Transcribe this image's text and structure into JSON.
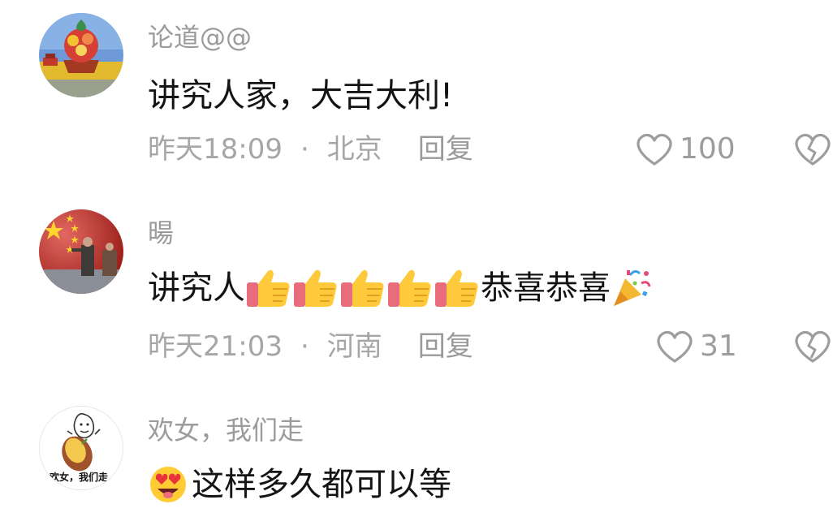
{
  "comments": [
    {
      "username": "论道@@",
      "text": "讲究人家，大吉大利!",
      "time": "昨天18:09",
      "separator": "·",
      "location": "北京",
      "reply_label": "回复",
      "likes": "100",
      "avatar_icon": "flower-basket-avatar"
    },
    {
      "username": "暘",
      "text_prefix": "讲究人",
      "thumbs_count": 5,
      "text_suffix": "恭喜恭喜",
      "time": "昨天21:03",
      "separator": "·",
      "location": "河南",
      "reply_label": "回复",
      "likes": "31",
      "avatar_icon": "flag-avatar"
    },
    {
      "username": "欢女，我们走",
      "text": "这样多久都可以等",
      "avatar_icon": "sticker-avatar",
      "avatar_caption": "欢女，我们走"
    }
  ],
  "colors": {
    "username": "#9b9b9b",
    "text": "#141414",
    "meta": "#a6a6a6"
  }
}
